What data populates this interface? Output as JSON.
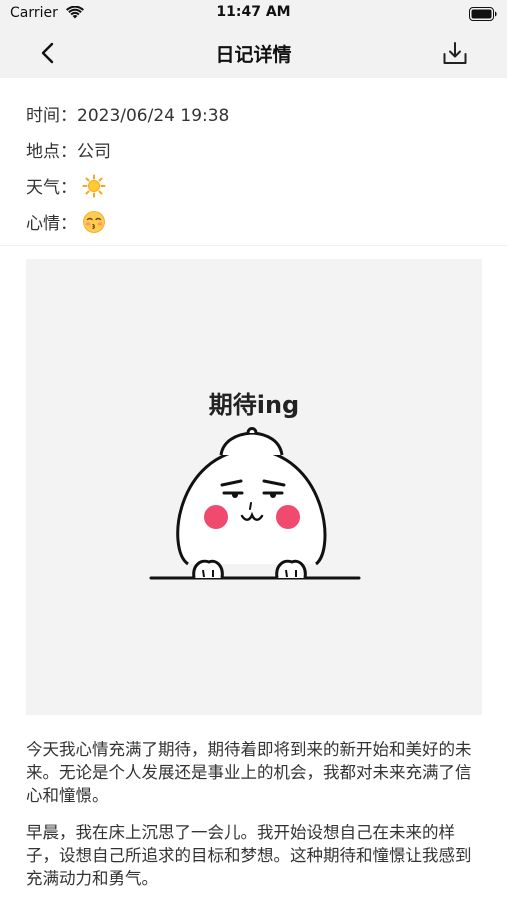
{
  "status_bar": {
    "carrier": "Carrier",
    "time": "11:47 AM"
  },
  "nav": {
    "title": "日记详情",
    "icons": {
      "back": "chevron-left-icon",
      "download": "download-icon"
    }
  },
  "meta": {
    "time_label": "时间：",
    "time_value": "2023/06/24 19:38",
    "place_label": "地点：",
    "place_value": "公司",
    "weather_label": "天气：",
    "weather_icon": "sun-icon",
    "mood_label": "心情：",
    "mood_icon": "kissing-face-icon"
  },
  "photo": {
    "caption": "期待ing"
  },
  "content": {
    "paragraphs": [
      "今天我心情充满了期待，期待着即将到来的新开始和美好的未来。无论是个人发展还是事业上的机会，我都对未来充满了信心和憧憬。",
      "早晨，我在床上沉思了一会儿。我开始设想自己在未来的样子，设想自己所追求的目标和梦想。这种期待和憧憬让我感到充满动力和勇气。"
    ]
  },
  "colors": {
    "bar_background": "#f2f2f2",
    "photo_background": "#f3f3f3",
    "text": "#333333",
    "cheek_pink": "#f04a6e"
  }
}
